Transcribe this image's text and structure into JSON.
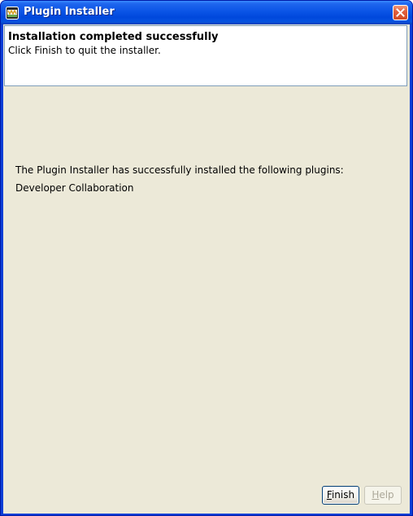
{
  "window": {
    "title": "Plugin Installer",
    "title_icon": "plugin-installer-app-icon",
    "close_icon": "close-icon",
    "colors": {
      "titlebar": "#0a54e6",
      "close_button": "#d24a24",
      "client_background": "#ece9d8"
    }
  },
  "header": {
    "title": "Installation completed successfully",
    "subtitle": "Click Finish to quit the installer."
  },
  "content": {
    "message": "The Plugin Installer has successfully installed the following plugins:",
    "plugins": [
      "Developer Collaboration"
    ]
  },
  "buttons": {
    "finish": {
      "mnemonic": "F",
      "rest": "inish",
      "enabled": true
    },
    "help": {
      "mnemonic": "H",
      "rest": "elp",
      "enabled": false
    }
  }
}
